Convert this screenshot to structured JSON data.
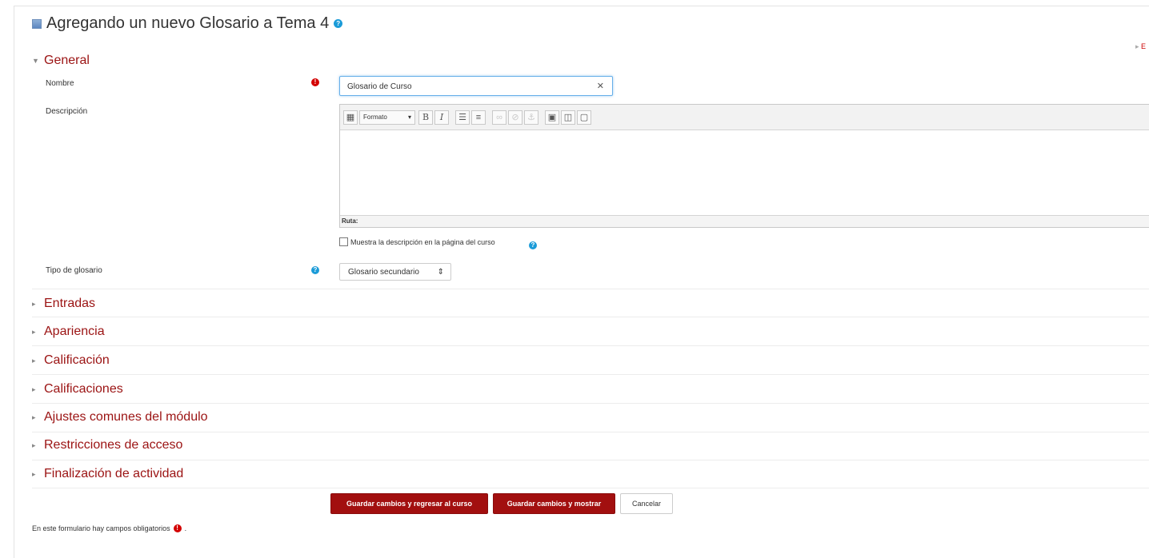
{
  "header": {
    "title": "Agregando un nuevo Glosario a Tema 4",
    "help_icon": "question-icon"
  },
  "expand_all": {
    "label": "E"
  },
  "sections": {
    "general": "General",
    "collapsed": [
      "Entradas",
      "Apariencia",
      "Calificación",
      "Calificaciones",
      "Ajustes comunes del módulo",
      "Restricciones de acceso",
      "Finalización de actividad"
    ]
  },
  "fields": {
    "nombre_label": "Nombre",
    "nombre_value": "Glosario de Curso",
    "descripcion_label": "Descripción",
    "format_select": "Formato",
    "editor_status": "Ruta:",
    "show_description_label": "Muestra la descripción en la página del curso",
    "tipo_label": "Tipo de glosario",
    "tipo_value": "Glosario secundario"
  },
  "buttons": {
    "save_return": "Guardar cambios y regresar al curso",
    "save_display": "Guardar cambios y mostrar",
    "cancel": "Cancelar"
  },
  "footer": {
    "required_note": "En este formulario hay campos obligatorios",
    "trailing": "."
  },
  "colors": {
    "section_heading": "#9b1313",
    "primary_button": "#a20f0f",
    "required_icon": "#d30000",
    "help_icon": "#1b9bd8",
    "input_focus": "#66afe9"
  }
}
